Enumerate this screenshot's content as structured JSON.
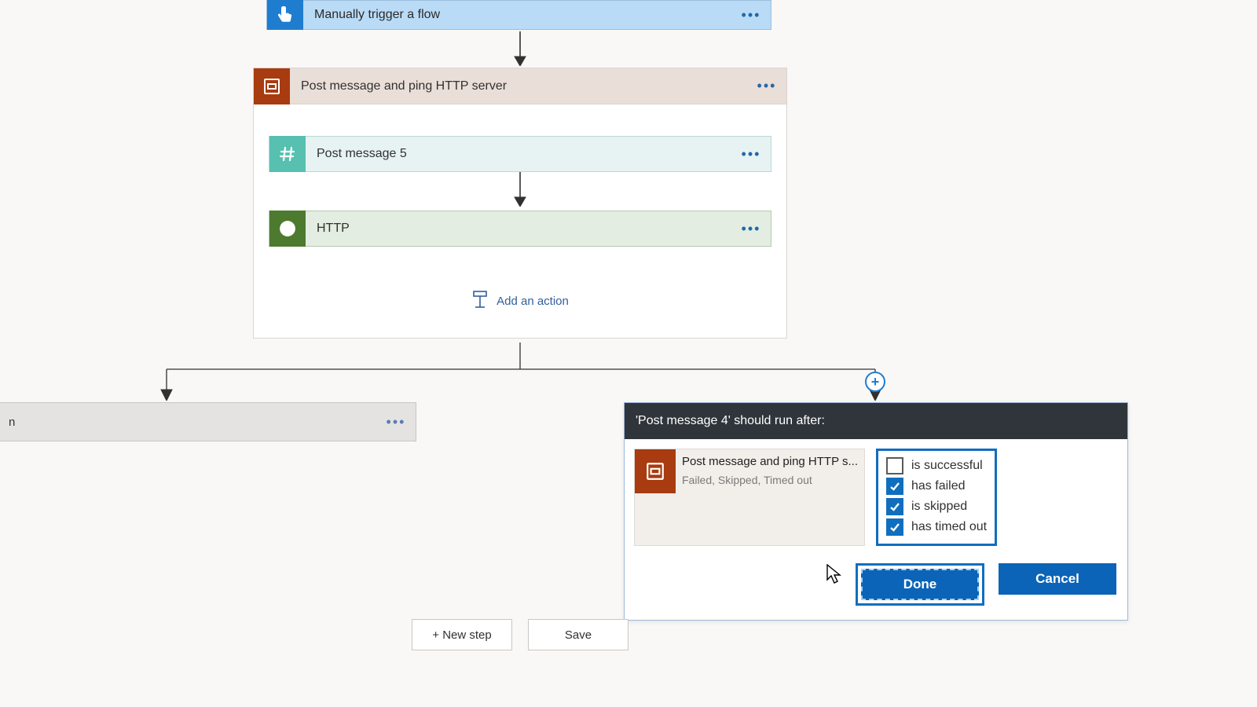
{
  "trigger": {
    "title": "Manually trigger a flow"
  },
  "scope": {
    "title": "Post message and ping HTTP server",
    "inner": {
      "post": "Post message 5",
      "http": "HTTP"
    },
    "add_action": "Add an action"
  },
  "left_card": {
    "title_tail": "n"
  },
  "runafter": {
    "header": "'Post message 4' should run after:",
    "prev_step": {
      "title": "Post message and ping HTTP s...",
      "sub": "Failed, Skipped, Timed out"
    },
    "conditions": [
      {
        "label": "is successful",
        "checked": false
      },
      {
        "label": "has failed",
        "checked": true
      },
      {
        "label": "is skipped",
        "checked": true
      },
      {
        "label": "has timed out",
        "checked": true
      }
    ],
    "done": "Done",
    "cancel": "Cancel"
  },
  "bottom": {
    "new_step": "+ New step",
    "save": "Save"
  }
}
